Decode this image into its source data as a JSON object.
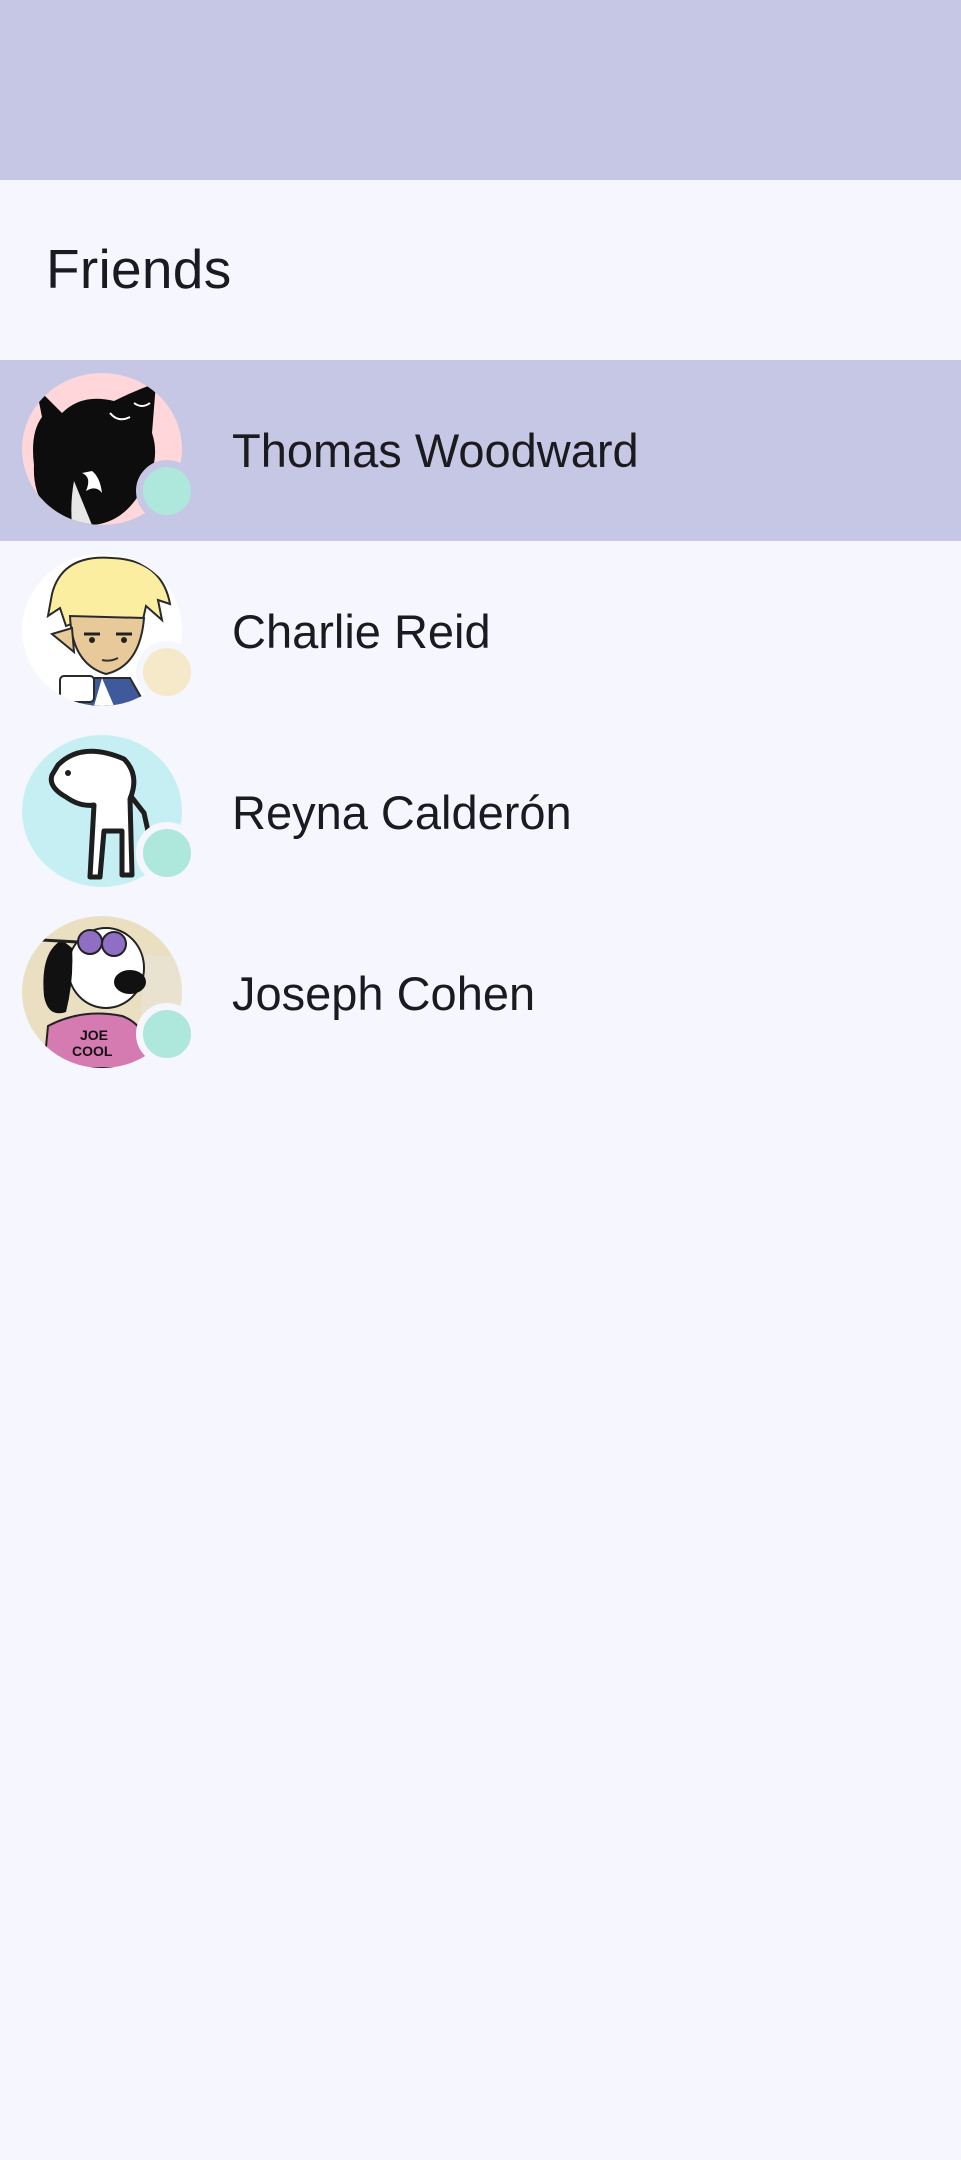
{
  "header": {
    "title": "Friends"
  },
  "colors": {
    "app_bar": "#c5c7e5",
    "background": "#f6f7fe",
    "selected_row": "#c5c7e5",
    "status_online": "#aee7dc",
    "status_away": "#f5e9c9"
  },
  "friends": [
    {
      "name": "Thomas Woodward",
      "avatar_icon": "black-cat-avatar-icon",
      "status": "online",
      "selected": true
    },
    {
      "name": "Charlie Reid",
      "avatar_icon": "blonde-elf-avatar-icon",
      "status": "away",
      "selected": false
    },
    {
      "name": "Reyna Calderón",
      "avatar_icon": "stick-figure-avatar-icon",
      "status": "online",
      "selected": false
    },
    {
      "name": "Joseph Cohen",
      "avatar_icon": "joe-cool-dog-avatar-icon",
      "status": "online",
      "selected": false
    }
  ]
}
